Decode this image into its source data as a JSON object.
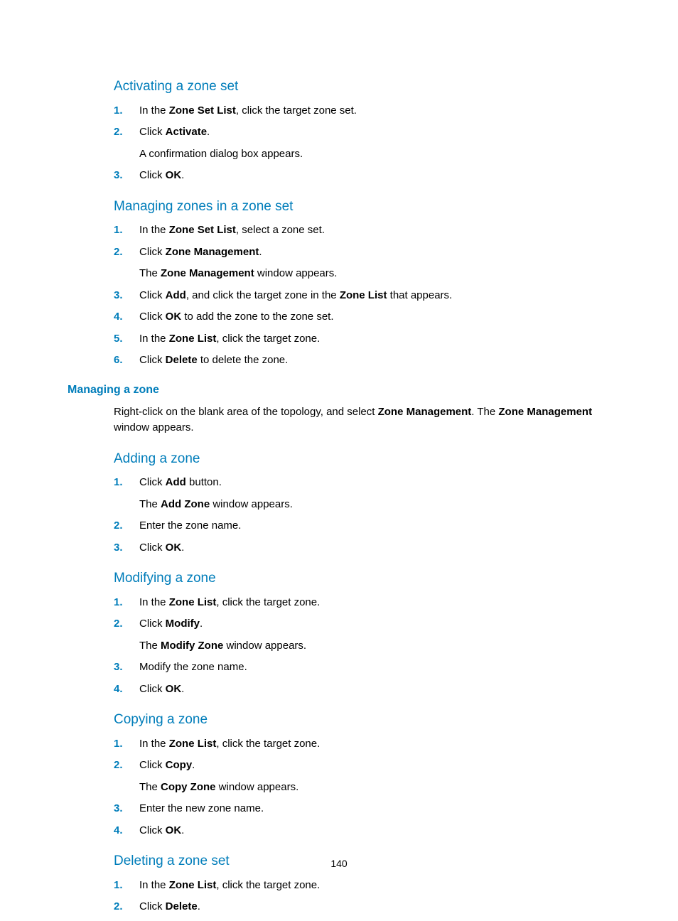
{
  "sections": {
    "activating": {
      "title": "Activating a zone set",
      "steps": [
        {
          "n": "1.",
          "html": "In the <b>Zone Set List</b>, click the target zone set."
        },
        {
          "n": "2.",
          "html": "Click <b>Activate</b>.",
          "sub": "A confirmation dialog box appears."
        },
        {
          "n": "3.",
          "html": "Click <b>OK</b>."
        }
      ]
    },
    "managing_zones_in_set": {
      "title": "Managing zones in a zone set",
      "steps": [
        {
          "n": "1.",
          "html": "In the <b>Zone Set List</b>, select a zone set."
        },
        {
          "n": "2.",
          "html": "Click <b>Zone Management</b>.",
          "subhtml": "The <b>Zone Management</b> window appears."
        },
        {
          "n": "3.",
          "html": "Click <b>Add</b>, and click the target zone in the <b>Zone List</b> that appears."
        },
        {
          "n": "4.",
          "html": "Click <b>OK</b> to add the zone to the zone set."
        },
        {
          "n": "5.",
          "html": "In the <b>Zone List</b>, click the target zone."
        },
        {
          "n": "6.",
          "html": "Click <b>Delete</b> to delete the zone."
        }
      ]
    },
    "managing_a_zone": {
      "title": "Managing a zone",
      "intro_html": "Right-click on the blank area of the topology, and select <b>Zone Management</b>. The <b>Zone Management</b> window appears."
    },
    "adding_a_zone": {
      "title": "Adding a zone",
      "steps": [
        {
          "n": "1.",
          "html": "Click <b>Add</b> button.",
          "subhtml": "The <b>Add Zone</b> window appears."
        },
        {
          "n": "2.",
          "html": "Enter the zone name."
        },
        {
          "n": "3.",
          "html": "Click <b>OK</b>."
        }
      ]
    },
    "modifying_a_zone": {
      "title": "Modifying a zone",
      "steps": [
        {
          "n": "1.",
          "html": "In the <b>Zone List</b>, click the target zone."
        },
        {
          "n": "2.",
          "html": "Click <b>Modify</b>.",
          "subhtml": "The <b>Modify Zone</b> window appears."
        },
        {
          "n": "3.",
          "html": "Modify the zone name."
        },
        {
          "n": "4.",
          "html": "Click <b>OK</b>."
        }
      ]
    },
    "copying_a_zone": {
      "title": "Copying a zone",
      "steps": [
        {
          "n": "1.",
          "html": "In the <b>Zone List</b>, click the target zone."
        },
        {
          "n": "2.",
          "html": "Click <b>Copy</b>.",
          "subhtml": "The <b>Copy Zone</b> window appears."
        },
        {
          "n": "3.",
          "html": "Enter the new zone name."
        },
        {
          "n": "4.",
          "html": "Click <b>OK</b>."
        }
      ]
    },
    "deleting_a_zone_set": {
      "title": "Deleting a zone set",
      "steps": [
        {
          "n": "1.",
          "html": "In the <b>Zone List</b>, click the target zone."
        },
        {
          "n": "2.",
          "html": "Click <b>Delete</b>."
        }
      ]
    }
  },
  "page_number": "140"
}
